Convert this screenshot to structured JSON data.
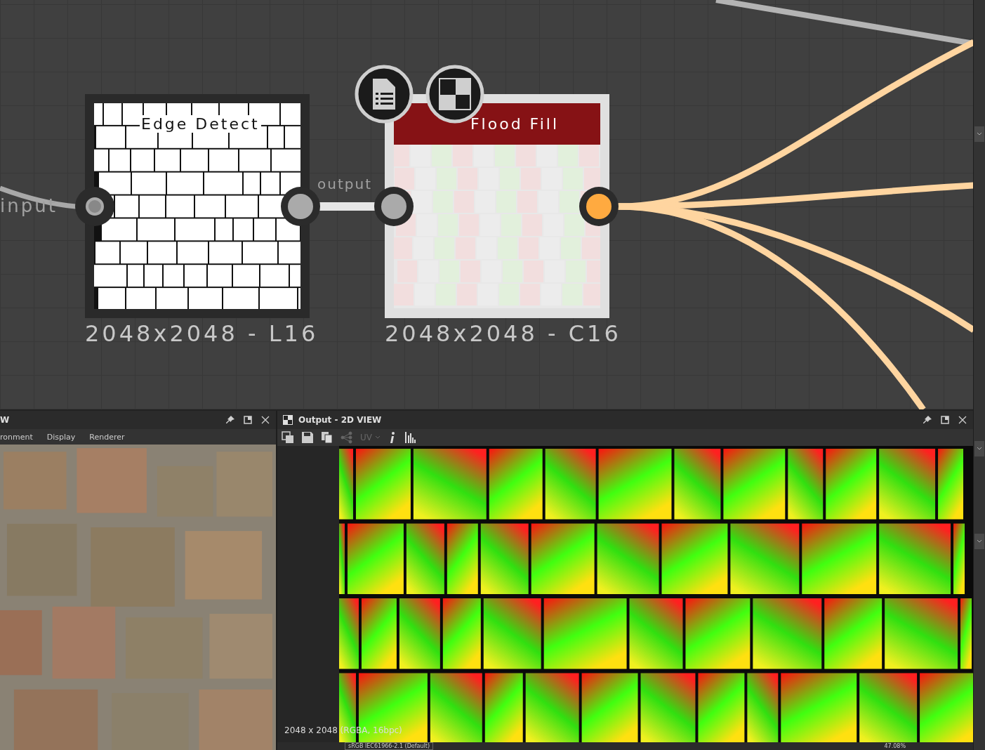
{
  "graph": {
    "nodes": [
      {
        "title": "Edge Detect",
        "kind": "grayscale",
        "info": "2048x2048 - L16",
        "selected": false
      },
      {
        "title": "Flood Fill",
        "kind": "color",
        "info": "2048x2048 - C16",
        "selected": true
      }
    ],
    "port_labels": [
      "input",
      "output"
    ]
  },
  "view3d": {
    "title": "W",
    "tabs": [
      "ronment",
      "Display",
      "Renderer"
    ]
  },
  "view2d": {
    "title": "Output - 2D VIEW",
    "uv_label": "UV",
    "image_info": "2048 x 2048 (RGBA, 16bpc)",
    "color_profile": "sRGB IEC61966-2.1 (Default)",
    "zoom": "47.08%"
  }
}
